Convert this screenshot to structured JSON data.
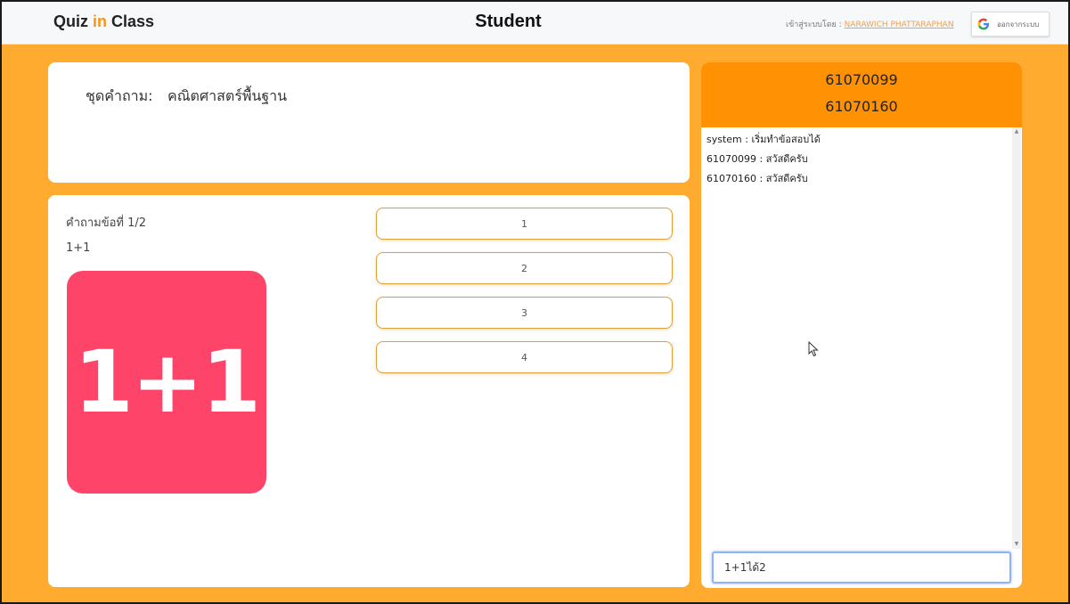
{
  "header": {
    "brand_prefix": "Quiz ",
    "brand_accent": "in",
    "brand_suffix": " Class",
    "title": "Student",
    "login_label": "เข้าสู่ระบบโดย : ",
    "login_user": "NARAWICH PHATTARAPHAN",
    "logout_label": "ออกจากระบบ",
    "logout_icon": "google-icon"
  },
  "question_set": {
    "label": "ชุดคำถาม:",
    "value": "คณิตศาสตร์พื้นฐาน"
  },
  "question": {
    "number_label": "คำถามข้อที่ 1/2",
    "text": "1+1",
    "image_text": "1+1",
    "image_color": "#ff4469",
    "answers": [
      "1",
      "2",
      "3",
      "4"
    ]
  },
  "chat": {
    "members": [
      "61070099",
      "61070160"
    ],
    "messages": [
      "system : เริ่มทำข้อสอบได้",
      "61070099 : สวัสดีครับ",
      "61070160 : สวัสดีครับ"
    ],
    "input_value": "1+1ได้2",
    "header_color": "#ff9204"
  },
  "colors": {
    "background": "#ffab30",
    "accent": "#f7941d",
    "answer_border": "#e0a13a"
  }
}
